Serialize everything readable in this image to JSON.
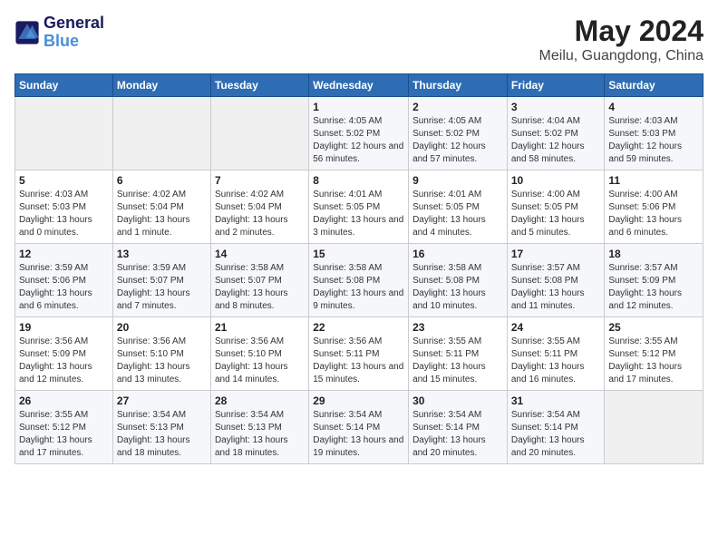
{
  "header": {
    "logo_line1": "General",
    "logo_line2": "Blue",
    "month": "May 2024",
    "location": "Meilu, Guangdong, China"
  },
  "weekdays": [
    "Sunday",
    "Monday",
    "Tuesday",
    "Wednesday",
    "Thursday",
    "Friday",
    "Saturday"
  ],
  "weeks": [
    [
      {
        "day": "",
        "info": ""
      },
      {
        "day": "",
        "info": ""
      },
      {
        "day": "",
        "info": ""
      },
      {
        "day": "1",
        "info": "Sunrise: 4:05 AM\nSunset: 5:02 PM\nDaylight: 12 hours and 56 minutes."
      },
      {
        "day": "2",
        "info": "Sunrise: 4:05 AM\nSunset: 5:02 PM\nDaylight: 12 hours and 57 minutes."
      },
      {
        "day": "3",
        "info": "Sunrise: 4:04 AM\nSunset: 5:02 PM\nDaylight: 12 hours and 58 minutes."
      },
      {
        "day": "4",
        "info": "Sunrise: 4:03 AM\nSunset: 5:03 PM\nDaylight: 12 hours and 59 minutes."
      }
    ],
    [
      {
        "day": "5",
        "info": "Sunrise: 4:03 AM\nSunset: 5:03 PM\nDaylight: 13 hours and 0 minutes."
      },
      {
        "day": "6",
        "info": "Sunrise: 4:02 AM\nSunset: 5:04 PM\nDaylight: 13 hours and 1 minute."
      },
      {
        "day": "7",
        "info": "Sunrise: 4:02 AM\nSunset: 5:04 PM\nDaylight: 13 hours and 2 minutes."
      },
      {
        "day": "8",
        "info": "Sunrise: 4:01 AM\nSunset: 5:05 PM\nDaylight: 13 hours and 3 minutes."
      },
      {
        "day": "9",
        "info": "Sunrise: 4:01 AM\nSunset: 5:05 PM\nDaylight: 13 hours and 4 minutes."
      },
      {
        "day": "10",
        "info": "Sunrise: 4:00 AM\nSunset: 5:05 PM\nDaylight: 13 hours and 5 minutes."
      },
      {
        "day": "11",
        "info": "Sunrise: 4:00 AM\nSunset: 5:06 PM\nDaylight: 13 hours and 6 minutes."
      }
    ],
    [
      {
        "day": "12",
        "info": "Sunrise: 3:59 AM\nSunset: 5:06 PM\nDaylight: 13 hours and 6 minutes."
      },
      {
        "day": "13",
        "info": "Sunrise: 3:59 AM\nSunset: 5:07 PM\nDaylight: 13 hours and 7 minutes."
      },
      {
        "day": "14",
        "info": "Sunrise: 3:58 AM\nSunset: 5:07 PM\nDaylight: 13 hours and 8 minutes."
      },
      {
        "day": "15",
        "info": "Sunrise: 3:58 AM\nSunset: 5:08 PM\nDaylight: 13 hours and 9 minutes."
      },
      {
        "day": "16",
        "info": "Sunrise: 3:58 AM\nSunset: 5:08 PM\nDaylight: 13 hours and 10 minutes."
      },
      {
        "day": "17",
        "info": "Sunrise: 3:57 AM\nSunset: 5:08 PM\nDaylight: 13 hours and 11 minutes."
      },
      {
        "day": "18",
        "info": "Sunrise: 3:57 AM\nSunset: 5:09 PM\nDaylight: 13 hours and 12 minutes."
      }
    ],
    [
      {
        "day": "19",
        "info": "Sunrise: 3:56 AM\nSunset: 5:09 PM\nDaylight: 13 hours and 12 minutes."
      },
      {
        "day": "20",
        "info": "Sunrise: 3:56 AM\nSunset: 5:10 PM\nDaylight: 13 hours and 13 minutes."
      },
      {
        "day": "21",
        "info": "Sunrise: 3:56 AM\nSunset: 5:10 PM\nDaylight: 13 hours and 14 minutes."
      },
      {
        "day": "22",
        "info": "Sunrise: 3:56 AM\nSunset: 5:11 PM\nDaylight: 13 hours and 15 minutes."
      },
      {
        "day": "23",
        "info": "Sunrise: 3:55 AM\nSunset: 5:11 PM\nDaylight: 13 hours and 15 minutes."
      },
      {
        "day": "24",
        "info": "Sunrise: 3:55 AM\nSunset: 5:11 PM\nDaylight: 13 hours and 16 minutes."
      },
      {
        "day": "25",
        "info": "Sunrise: 3:55 AM\nSunset: 5:12 PM\nDaylight: 13 hours and 17 minutes."
      }
    ],
    [
      {
        "day": "26",
        "info": "Sunrise: 3:55 AM\nSunset: 5:12 PM\nDaylight: 13 hours and 17 minutes."
      },
      {
        "day": "27",
        "info": "Sunrise: 3:54 AM\nSunset: 5:13 PM\nDaylight: 13 hours and 18 minutes."
      },
      {
        "day": "28",
        "info": "Sunrise: 3:54 AM\nSunset: 5:13 PM\nDaylight: 13 hours and 18 minutes."
      },
      {
        "day": "29",
        "info": "Sunrise: 3:54 AM\nSunset: 5:14 PM\nDaylight: 13 hours and 19 minutes."
      },
      {
        "day": "30",
        "info": "Sunrise: 3:54 AM\nSunset: 5:14 PM\nDaylight: 13 hours and 20 minutes."
      },
      {
        "day": "31",
        "info": "Sunrise: 3:54 AM\nSunset: 5:14 PM\nDaylight: 13 hours and 20 minutes."
      },
      {
        "day": "",
        "info": ""
      }
    ]
  ]
}
